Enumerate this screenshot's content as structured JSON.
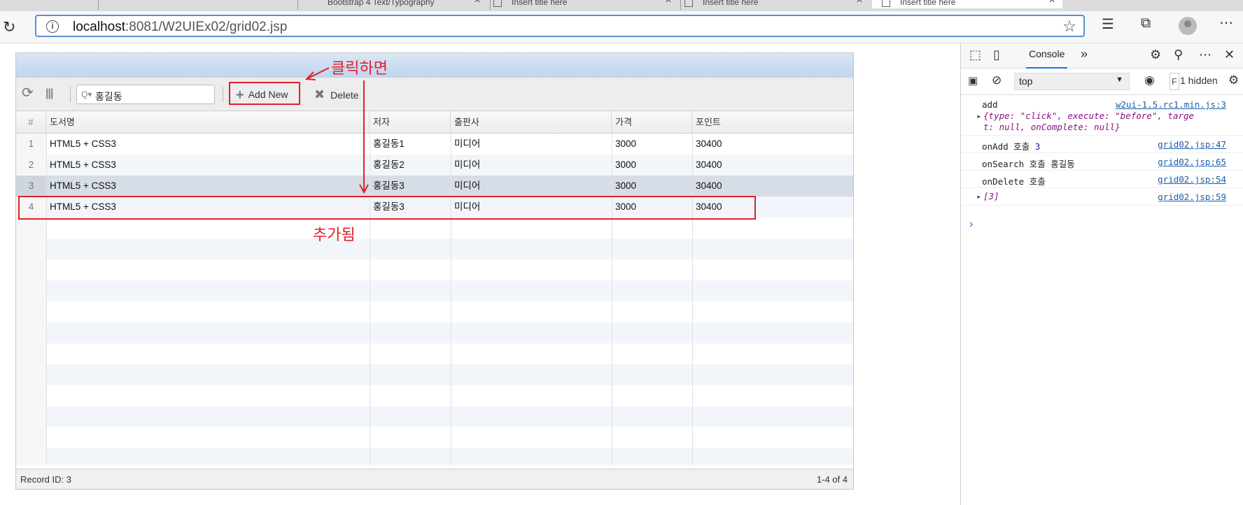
{
  "browser": {
    "tabs": [
      {
        "title": "Bootstrap 4 Text/Typography"
      },
      {
        "title": "Insert title here"
      },
      {
        "title": "Insert title here"
      },
      {
        "title": "Insert title here"
      }
    ],
    "url_host": "localhost",
    "url_rest": ":8081/W2UIEx02/grid02.jsp"
  },
  "grid": {
    "toolbar": {
      "search_value": "홍길동",
      "add_label": "Add New",
      "delete_label": "Delete"
    },
    "columns": [
      "#",
      "도서명",
      "저자",
      "출판사",
      "가격",
      "포인트"
    ],
    "rows": [
      {
        "num": "1",
        "title": "HTML5 + CSS3",
        "author": "홍길동1",
        "publisher": "미디어",
        "price": "3000",
        "point": "30400"
      },
      {
        "num": "2",
        "title": "HTML5 + CSS3",
        "author": "홍길동2",
        "publisher": "미디어",
        "price": "3000",
        "point": "30400"
      },
      {
        "num": "3",
        "title": "HTML5 + CSS3",
        "author": "홍길동3",
        "publisher": "미디어",
        "price": "3000",
        "point": "30400"
      },
      {
        "num": "4",
        "title": "HTML5 + CSS3",
        "author": "홍길동3",
        "publisher": "미디어",
        "price": "3000",
        "point": "30400"
      }
    ],
    "footer_left": "Record ID: 3",
    "footer_right": "1-4 of 4"
  },
  "annotations": {
    "click_label": "클릭하면",
    "added_label": "추가됨",
    "color": "#e0202a"
  },
  "devtools": {
    "tab_console": "Console",
    "context": "top",
    "hidden": "1 hidden",
    "logs": [
      {
        "msg": "add",
        "src": "w2ui-1.5.rc1.min.js:3"
      },
      {
        "obj_line1": "{type: \"click\", execute: \"before\", targe",
        "obj_line2": "t: null, onComplete: null}"
      },
      {
        "msg": "onAdd 호출",
        "num": "3",
        "src": "grid02.jsp:47"
      },
      {
        "msg": "onSearch 호출 홍길동",
        "src": "grid02.jsp:65"
      },
      {
        "msg": "onDelete 호출",
        "src": "grid02.jsp:54"
      },
      {
        "msg": "[3]",
        "src": "grid02.jsp:59"
      }
    ]
  }
}
